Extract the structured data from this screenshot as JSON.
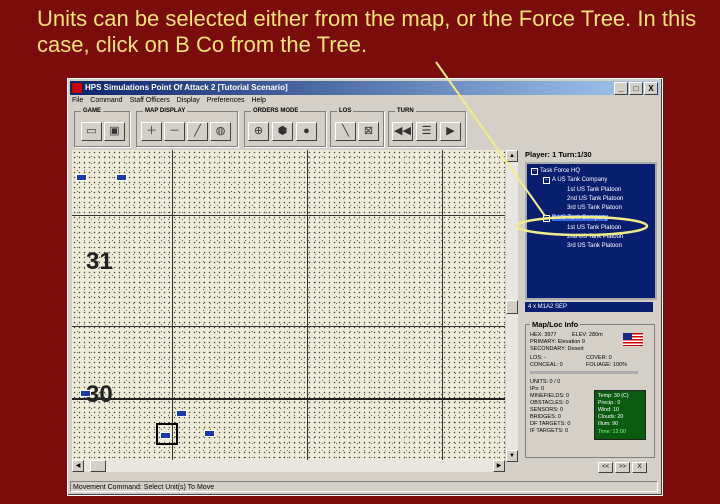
{
  "caption": "Units can be selected either from the map, or the Force Tree.  In this case, click on B Co from the Tree.",
  "window": {
    "title": "HPS Simulations Point Of Attack 2 [Tutorial Scenario]",
    "btn_min": "_",
    "btn_max": "□",
    "btn_close": "X"
  },
  "menu": [
    "File",
    "Command",
    "Staff Officers",
    "Display",
    "Preferences",
    "Help"
  ],
  "toolbar": {
    "game_label": "GAME",
    "map_display_label": "MAP DISPLAY",
    "orders_mode_label": "ORDERS MODE",
    "los_label": "LOS",
    "turn_label": "TURN"
  },
  "map": {
    "hex_row_31": "31",
    "hex_row_30": "30"
  },
  "player_line": "Player: 1  Turn:1/30",
  "tree": [
    {
      "label": "Task Force HQ",
      "exp": "−"
    },
    {
      "label": "A US Tank Company",
      "exp": "−"
    },
    {
      "label": "1st US Tank Platoon"
    },
    {
      "label": "2nd US Tank Platoon"
    },
    {
      "label": "3rd US Tank Platoon"
    },
    {
      "label": "B US Tank Company",
      "exp": "−"
    },
    {
      "label": "1st US Tank Platoon"
    },
    {
      "label": "2nd US Tank Platoon"
    },
    {
      "label": "3rd US Tank Platoon"
    }
  ],
  "unit_bar": "4 x M1A2 SEP",
  "map_info": {
    "header": "Map/Loc Info",
    "hex": "HEX: 3977",
    "elev": "ELEV:  280m",
    "primary": "PRIMARY: Elevation 9",
    "secondary": "SECONDARY: Desert",
    "los": "LOS: -",
    "cover": "COVER: 0",
    "conceal": "CONCEAL: 0",
    "foliage": "FOLIAGE: 100%",
    "units": "UNITS: 0 / 0",
    "ips": "IPs: 0",
    "minefields": "MINEFIELDS: 0",
    "obstacles": "OBSTACLES: 0",
    "sensors": "SENSORS: 0",
    "bridges": "BRIDGES: 0",
    "df_targets": "DF TARGETS: 0",
    "if_targets": "IF TARGETS: 0"
  },
  "weather": {
    "temp": "Temp: 30 (C)",
    "precip": "Precip.: 0",
    "wind": "Wind: 10",
    "clouds": "Clouds: 20",
    "illum": "Illum: 90",
    "time": "Time: 12:00"
  },
  "nav": {
    "prev": "<<",
    "next": ">>",
    "close": "X"
  },
  "status": "Movement Command: Select Unit(s) To Move",
  "colors": {
    "background": "#7a0c0c",
    "caption": "#f4e27a",
    "highlight": "#f2ec88",
    "tree_bg": "#0a1e70"
  }
}
